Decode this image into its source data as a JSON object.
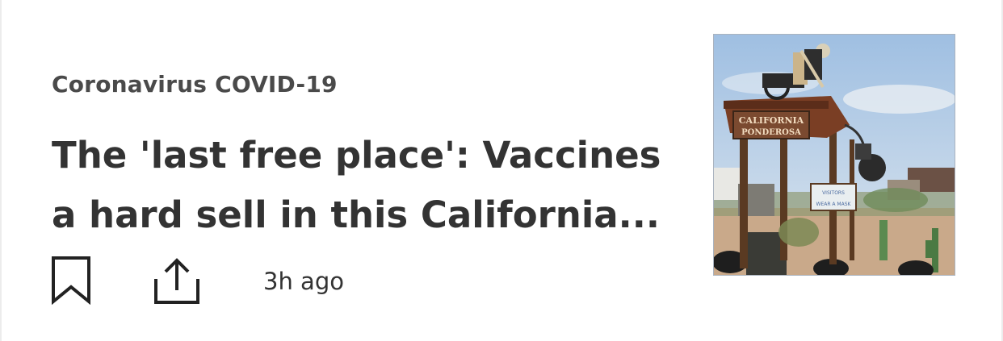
{
  "article": {
    "category": "Coronavirus COVID-19",
    "headline": "The 'last free place': Vaccines a hard sell in this California...",
    "timestamp": "3h ago"
  },
  "actions": {
    "bookmark_icon": "bookmark-icon",
    "share_icon": "share-icon"
  },
  "thumbnail": {
    "sign_line1": "CALIFORNIA",
    "sign_line2": "PONDEROSA",
    "sign_small_line1": "VISITORS",
    "sign_small_line2": "WEAR A MASK"
  },
  "colors": {
    "text_primary": "#333333",
    "text_category": "#4a4a4a",
    "sky": "#b9cfe6",
    "ground": "#c9a98a"
  }
}
